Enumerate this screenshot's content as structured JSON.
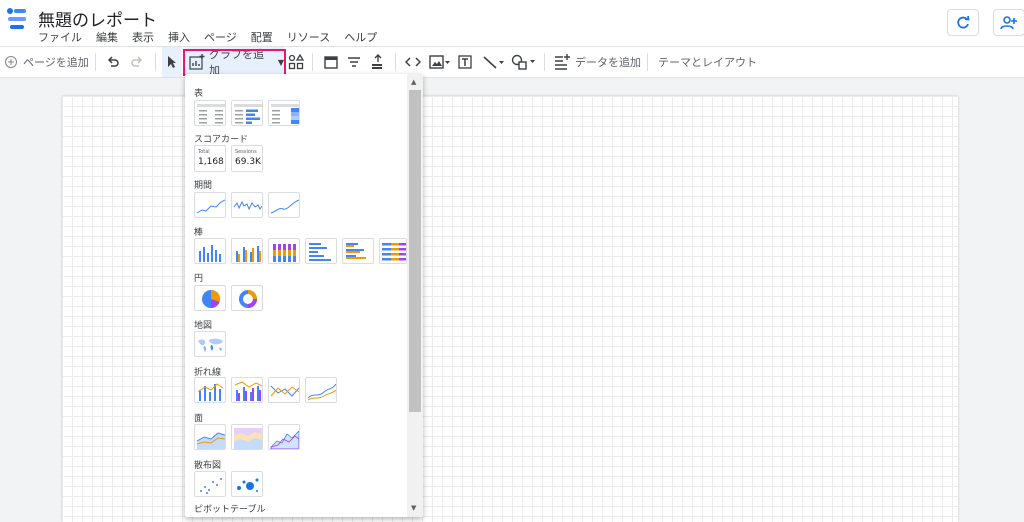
{
  "app": {
    "title": "無題のレポート",
    "menu": [
      "ファイル",
      "編集",
      "表示",
      "挿入",
      "ページ",
      "配置",
      "リソース",
      "ヘルプ"
    ]
  },
  "toolbar": {
    "add_page": "ページを追加",
    "add_chart": "グラフを追加",
    "add_data": "データを追加",
    "theme_layout": "テーマとレイアウト"
  },
  "chart_menu": {
    "sections": {
      "table": "表",
      "scorecard": "スコアカード",
      "time_series": "期間",
      "bar": "棒",
      "pie": "円",
      "geo": "地図",
      "combo": "折れ線",
      "area": "面",
      "scatter": "散布図",
      "pivot": "ピボットテーブル"
    },
    "scorecards": [
      {
        "label": "Total",
        "value": "1,168"
      },
      {
        "label": "Sessions",
        "value": "69.3K"
      }
    ]
  },
  "colors": {
    "blue": "#4285f4",
    "orange": "#f29900",
    "purple": "#a142f4",
    "highlight": "#e8176b"
  }
}
